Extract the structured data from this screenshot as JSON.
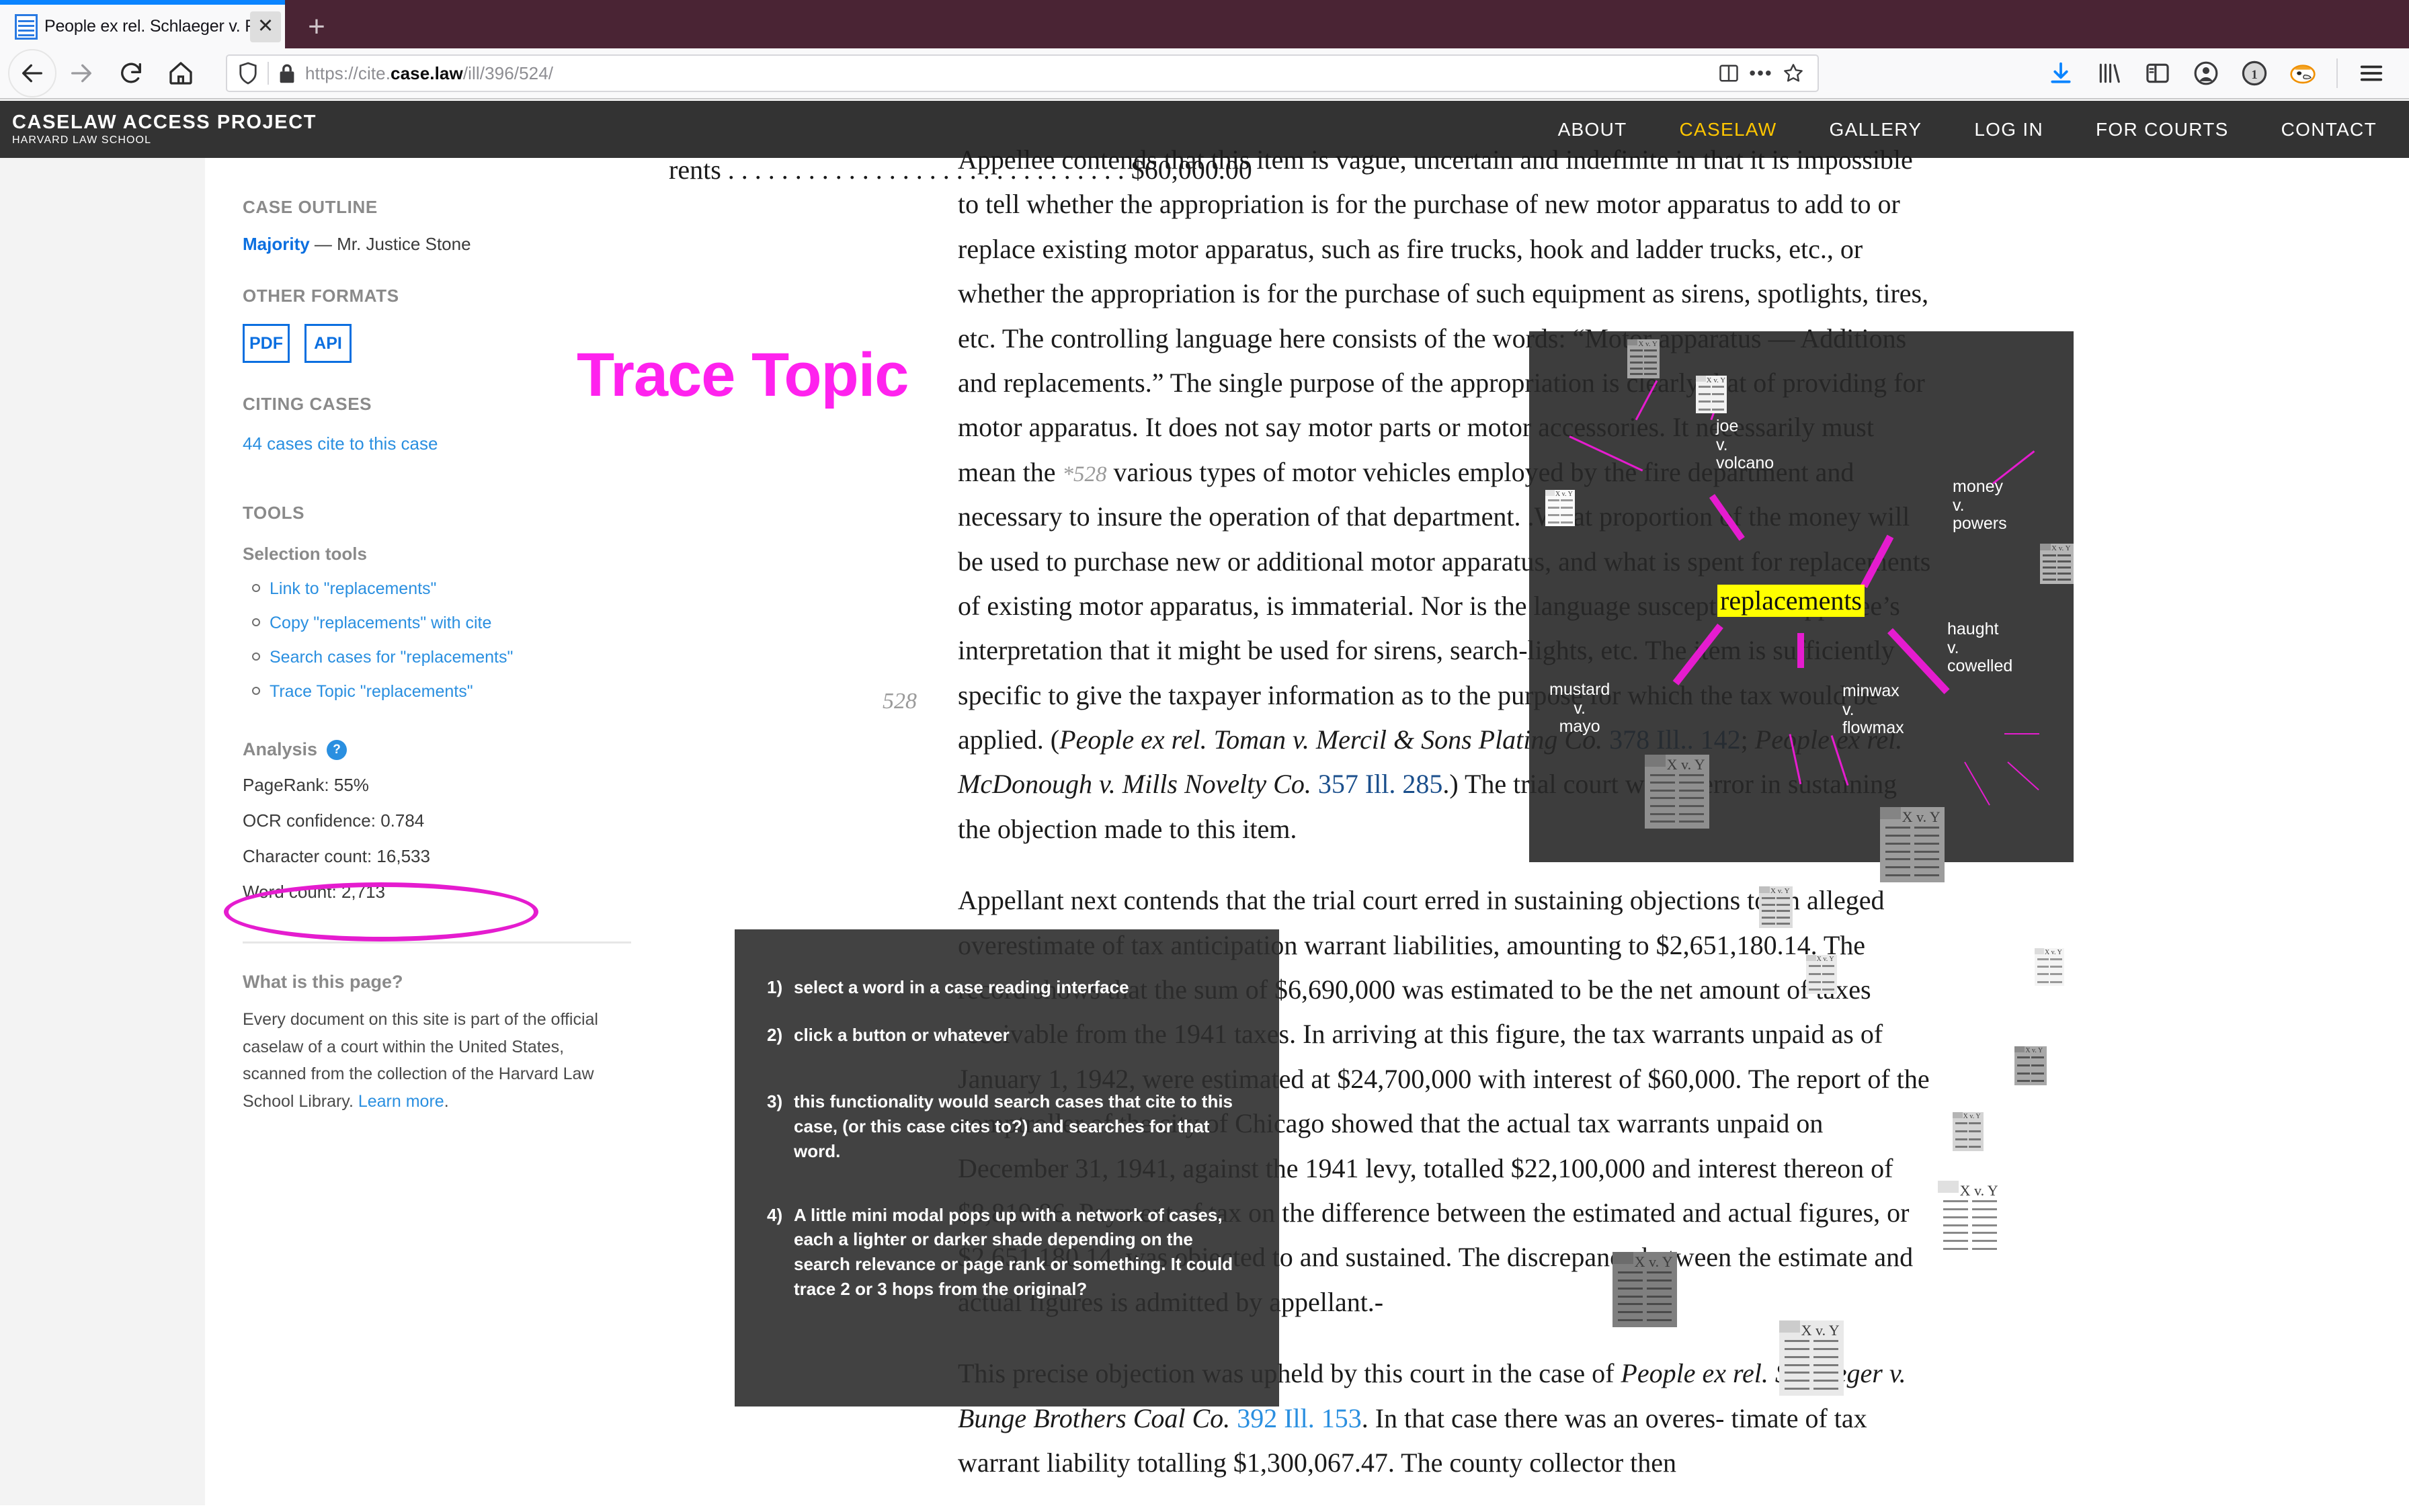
{
  "browser": {
    "tab_title": "People ex rel. Schlaeger v. Fran",
    "close_label": "✕",
    "new_tab_label": "+",
    "url_prefix": "https://cite.",
    "url_domain": "case.law",
    "url_path": "/ill/396/524/",
    "url_full": "https://cite.case.law/ill/396/524/",
    "dots_label": "•••"
  },
  "site_header": {
    "logo_main": "CASELAW ACCESS PROJECT",
    "logo_sub": "HARVARD LAW SCHOOL",
    "nav": [
      {
        "label": "ABOUT",
        "active": false
      },
      {
        "label": "CASELAW",
        "active": true
      },
      {
        "label": "GALLERY",
        "active": false
      },
      {
        "label": "LOG IN",
        "active": false
      },
      {
        "label": "FOR COURTS",
        "active": false
      },
      {
        "label": "CONTACT",
        "active": false
      }
    ],
    "accent_color": "#ffc600",
    "bg_color": "#333333"
  },
  "sidebar": {
    "case_outline_title": "CASE OUTLINE",
    "majority_link": "Majority",
    "majority_author": "— Mr. Justice Stone",
    "other_formats_title": "OTHER FORMATS",
    "formats": [
      {
        "label": "PDF"
      },
      {
        "label": "API"
      }
    ],
    "citing_cases_title": "CITING CASES",
    "citing_cases_link": "44 cases cite to this case",
    "tools_title": "TOOLS",
    "selection_tools_label": "Selection tools",
    "selection_tools": [
      {
        "label": "Link to \"replacements\""
      },
      {
        "label": "Copy \"replacements\" with cite"
      },
      {
        "label": "Search cases for \"replacements\""
      },
      {
        "label": "Trace Topic \"replacements\"",
        "highlighted": true
      }
    ],
    "analysis_label": "Analysis",
    "analysis_help_label": "?",
    "analysis": [
      {
        "label": "PageRank: 55%"
      },
      {
        "label": "OCR confidence: 0.784"
      },
      {
        "label": "Character count: 16,533"
      },
      {
        "label": "Word count: 2,713"
      }
    ],
    "what_title": "What is this page?",
    "what_body": "Every document on this site is part of the official caselaw of a court within the United States, scanned from the collection of the Harvard Law School Library. ",
    "what_link": "Learn more",
    "what_body_end": "."
  },
  "case": {
    "page_number_gutter": "528",
    "dotted_head": "rents . . . . . . . . . . . . . . . . . . . . . . . . . . . . . . $60,000.00",
    "paragraph_1_a": "Appellee contends that this item is vague, uncertain and indefinite in that it is impossible to tell whether the appropriation is for the purchase of new motor apparatus to add to or replace existing motor apparatus, such as fire trucks, hook and ladder trucks, etc., or whether the appropriation is for the purchase of such equipment as sirens, spotlights, tires, etc. The controlling language here consists of the words: “Motor apparatus — Additions and replacements.” The single purpose of the appropriation is clearly that of providing for motor apparatus. It does not say motor parts or motor accessories. It necessarily must mean the ",
    "inline_page_marker": "*528",
    "paragraph_1_b": " various types of motor vehicles employed by the fire department and necessary to insure the operation of that department. .What proportion of the money will be used to purchase new or additional motor apparatus, and what is spent for replacements of existing motor apparatus, is immaterial. Nor is the language susceptible of appellee’s interpretation that it might be used for sirens, search-lights, etc. The item is sufficiently specific to give the taxpayer information as to the purpose for which the tax would be applied. (",
    "cite_1_italic": "People ex rel. Toman v. Mercil & Sons Plating Co.",
    "cite_1_link": "378 Ill.. 142",
    "cite_joiner": "; ",
    "cite_2_italic": "People ex rel. McDonough v. Mills Novelty Co.",
    "cite_2_link": "357 Ill. 285",
    "paragraph_1_c": ".) The trial court was in error in sustaining the objection made to this item.",
    "paragraph_2": "Appellant next contends that the trial court erred in sustaining objections to an alleged overestimate of tax anticipation warrant liabilities, amounting to $2,651,180.14. The record shows that the sum of $6,690,000 was estimated to be the net amount of taxes receivable from the 1941 taxes. In arriving at this figure, the tax warrants unpaid as of January 1, 1942, were estimated at $24,700,000 with interest of $60,000. The report of the comptroller of the city of Chicago showed that the actual tax warrants unpaid on December 31, 1941, against the 1941 levy, totalled $22,100,000 and interest thereon of $8,819.86. Payment of tax on the difference between the estimated and actual figures, or $2,651,180.14, was objected to and sustained. The discrepancy between the estimate and actual figures is admitted by appellant.-",
    "paragraph_3_a": "This precise objection was upheld by this court in the case of ",
    "paragraph_3_italic": "People ex rel. Schlaeger v. Bunge Brothers Coal Co.",
    "paragraph_3_link": "392 Ill. 153",
    "paragraph_3_b": ". In that case there was an overes-",
    "paragraph_3_c": "timate of tax warrant liability totalling $1,300,067.47. The county collector then"
  },
  "annotations": {
    "trace_topic_title": "Trace Topic",
    "title_color": "#ff22ee",
    "ellipse_color": "#e51ccf",
    "notes": [
      {
        "num": "1)",
        "text": "select a word in a case reading interface"
      },
      {
        "num": "2)",
        "text": "click a button or whatever"
      },
      {
        "num": "3)",
        "text": "this functionality would search cases that cite to this case, (or this case cites to?) and searches for that word."
      },
      {
        "num": "4)",
        "text": "A little mini modal pops up with a network of cases, each a lighter or darker shade depending on the search relevance or page rank or something. It could trace 2 or 3 hops from the original?"
      }
    ]
  },
  "network": {
    "center_word": "replacements",
    "highlight_color": "#ffff00",
    "edge_color": "#e51ccf",
    "doc_label": "X v. Y",
    "nodes": [
      {
        "name": "joe\nv.\nvolcano",
        "label_lines": [
          "joe",
          "v.",
          "volcano"
        ]
      },
      {
        "name": "money\nv.\npowers",
        "label_lines": [
          "money",
          "v.",
          "powers"
        ]
      },
      {
        "name": "haught\nv.\ncowelled",
        "label_lines": [
          "haught",
          "v.",
          "cowelled"
        ]
      },
      {
        "name": "mustard\nv.\nmayo",
        "label_lines": [
          "mustard",
          "v.",
          "mayo"
        ]
      },
      {
        "name": "minwax\nv.\nflowmax",
        "label_lines": [
          "minwax",
          "v.",
          "flowmax"
        ]
      }
    ]
  }
}
